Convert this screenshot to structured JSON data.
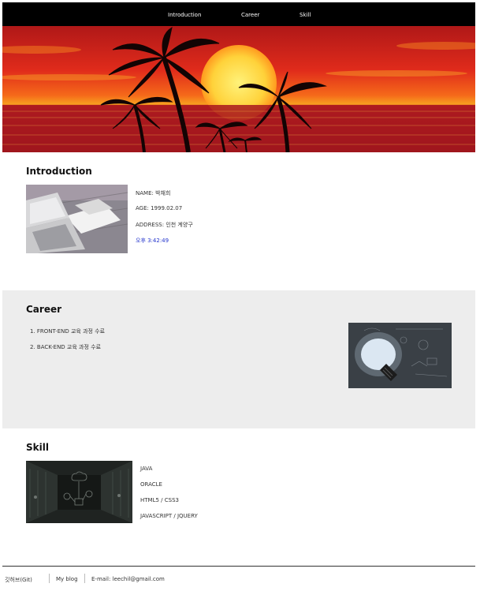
{
  "nav": {
    "items": [
      "Introduction",
      "Career",
      "Skill"
    ]
  },
  "introduction": {
    "title": "Introduction",
    "name": "NAME: 박채희",
    "age": "AGE: 1999.02.07",
    "address": "ADDRESS: 인천 계양구",
    "time": "오후 3:42:49"
  },
  "career": {
    "title": "Career",
    "items": [
      "FRONT-END 교육 과정 수료",
      "BACK-END 교육 과정 수료"
    ]
  },
  "skill": {
    "title": "Skill",
    "items": [
      "JAVA",
      "ORACLE",
      "HTML5 / CSS3",
      "JAVASCRIPT / JQUERY"
    ]
  },
  "footer": {
    "git": "깃허브(Git)",
    "blog": "My blog",
    "email": "E-mail: leechil@gmail.com"
  },
  "colors": {
    "nav_bg": "#000000",
    "career_bg": "#ededed",
    "time_text": "#2233cc"
  }
}
